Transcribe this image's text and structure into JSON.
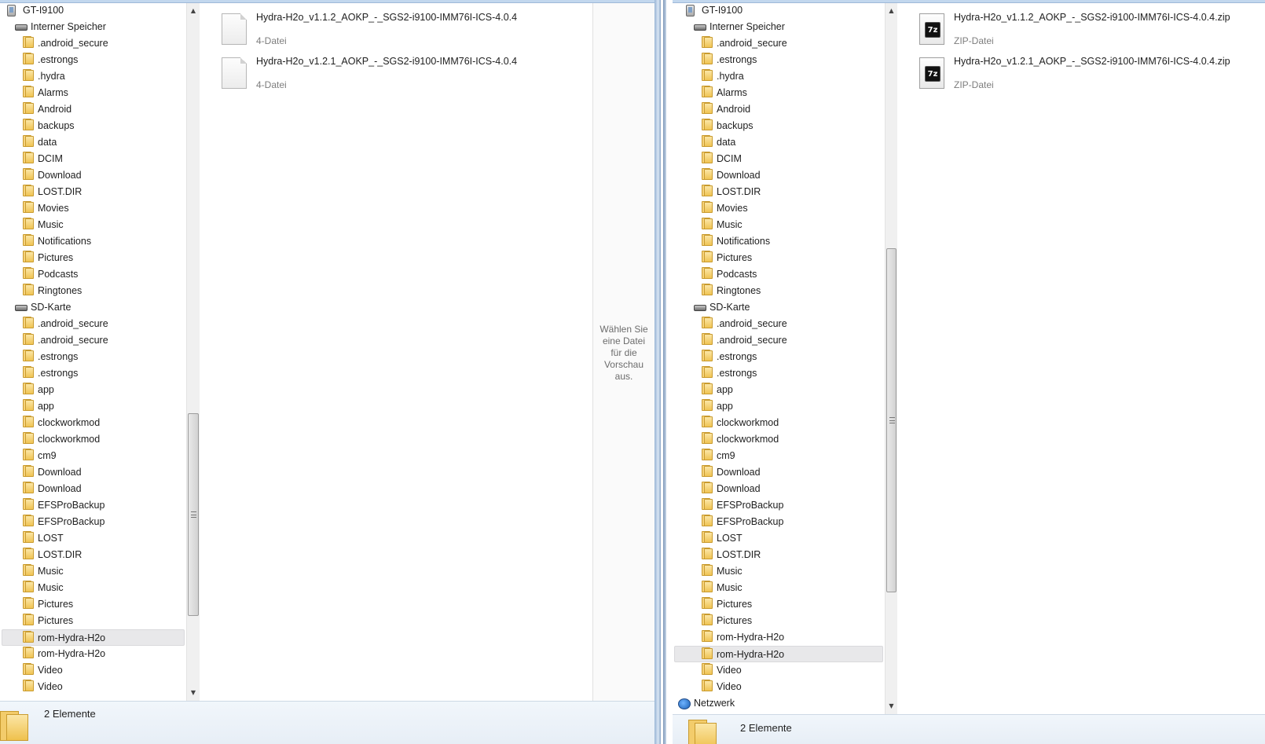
{
  "left": {
    "tree": [
      {
        "label": "GT-I9100",
        "type": "device"
      },
      {
        "label": "Interner Speicher",
        "type": "drive"
      },
      {
        "label": ".android_secure",
        "type": "folder"
      },
      {
        "label": ".estrongs",
        "type": "folder"
      },
      {
        "label": ".hydra",
        "type": "folder"
      },
      {
        "label": "Alarms",
        "type": "folder"
      },
      {
        "label": "Android",
        "type": "folder"
      },
      {
        "label": "backups",
        "type": "folder"
      },
      {
        "label": "data",
        "type": "folder"
      },
      {
        "label": "DCIM",
        "type": "folder"
      },
      {
        "label": "Download",
        "type": "folder"
      },
      {
        "label": "LOST.DIR",
        "type": "folder"
      },
      {
        "label": "Movies",
        "type": "folder"
      },
      {
        "label": "Music",
        "type": "folder"
      },
      {
        "label": "Notifications",
        "type": "folder"
      },
      {
        "label": "Pictures",
        "type": "folder"
      },
      {
        "label": "Podcasts",
        "type": "folder"
      },
      {
        "label": "Ringtones",
        "type": "folder"
      },
      {
        "label": "SD-Karte",
        "type": "drive"
      },
      {
        "label": ".android_secure",
        "type": "folder"
      },
      {
        "label": ".android_secure",
        "type": "folder"
      },
      {
        "label": ".estrongs",
        "type": "folder"
      },
      {
        "label": ".estrongs",
        "type": "folder"
      },
      {
        "label": "app",
        "type": "folder"
      },
      {
        "label": "app",
        "type": "folder"
      },
      {
        "label": "clockworkmod",
        "type": "folder"
      },
      {
        "label": "clockworkmod",
        "type": "folder"
      },
      {
        "label": "cm9",
        "type": "folder"
      },
      {
        "label": "Download",
        "type": "folder"
      },
      {
        "label": "Download",
        "type": "folder"
      },
      {
        "label": "EFSProBackup",
        "type": "folder"
      },
      {
        "label": "EFSProBackup",
        "type": "folder"
      },
      {
        "label": "LOST",
        "type": "folder"
      },
      {
        "label": "LOST.DIR",
        "type": "folder"
      },
      {
        "label": "Music",
        "type": "folder"
      },
      {
        "label": "Music",
        "type": "folder"
      },
      {
        "label": "Pictures",
        "type": "folder"
      },
      {
        "label": "Pictures",
        "type": "folder"
      },
      {
        "label": "rom-Hydra-H2o",
        "type": "folder",
        "selected": true
      },
      {
        "label": "rom-Hydra-H2o",
        "type": "folder"
      },
      {
        "label": "Video",
        "type": "folder"
      },
      {
        "label": "Video",
        "type": "folder"
      }
    ],
    "files": [
      {
        "name": "Hydra-H2o_v1.1.2_AOKP_-_SGS2-i9100-IMM76I-ICS-4.0.4",
        "type": "4-Datei",
        "icon": "generic-file-icon"
      },
      {
        "name": "Hydra-H2o_v1.2.1_AOKP_-_SGS2-i9100-IMM76I-ICS-4.0.4",
        "type": "4-Datei",
        "icon": "generic-file-icon"
      }
    ],
    "preview_message": "Wählen Sie eine Datei für die Vorschau aus.",
    "status": "2 Elemente"
  },
  "right": {
    "tree": [
      {
        "label": "GT-I9100",
        "type": "device"
      },
      {
        "label": "Interner Speicher",
        "type": "drive"
      },
      {
        "label": ".android_secure",
        "type": "folder"
      },
      {
        "label": ".estrongs",
        "type": "folder"
      },
      {
        "label": ".hydra",
        "type": "folder"
      },
      {
        "label": "Alarms",
        "type": "folder"
      },
      {
        "label": "Android",
        "type": "folder"
      },
      {
        "label": "backups",
        "type": "folder"
      },
      {
        "label": "data",
        "type": "folder"
      },
      {
        "label": "DCIM",
        "type": "folder"
      },
      {
        "label": "Download",
        "type": "folder"
      },
      {
        "label": "LOST.DIR",
        "type": "folder"
      },
      {
        "label": "Movies",
        "type": "folder"
      },
      {
        "label": "Music",
        "type": "folder"
      },
      {
        "label": "Notifications",
        "type": "folder"
      },
      {
        "label": "Pictures",
        "type": "folder"
      },
      {
        "label": "Podcasts",
        "type": "folder"
      },
      {
        "label": "Ringtones",
        "type": "folder"
      },
      {
        "label": "SD-Karte",
        "type": "drive"
      },
      {
        "label": ".android_secure",
        "type": "folder"
      },
      {
        "label": ".android_secure",
        "type": "folder"
      },
      {
        "label": ".estrongs",
        "type": "folder"
      },
      {
        "label": ".estrongs",
        "type": "folder"
      },
      {
        "label": "app",
        "type": "folder"
      },
      {
        "label": "app",
        "type": "folder"
      },
      {
        "label": "clockworkmod",
        "type": "folder"
      },
      {
        "label": "clockworkmod",
        "type": "folder"
      },
      {
        "label": "cm9",
        "type": "folder"
      },
      {
        "label": "Download",
        "type": "folder"
      },
      {
        "label": "Download",
        "type": "folder"
      },
      {
        "label": "EFSProBackup",
        "type": "folder"
      },
      {
        "label": "EFSProBackup",
        "type": "folder"
      },
      {
        "label": "LOST",
        "type": "folder"
      },
      {
        "label": "LOST.DIR",
        "type": "folder"
      },
      {
        "label": "Music",
        "type": "folder"
      },
      {
        "label": "Music",
        "type": "folder"
      },
      {
        "label": "Pictures",
        "type": "folder"
      },
      {
        "label": "Pictures",
        "type": "folder"
      },
      {
        "label": "rom-Hydra-H2o",
        "type": "folder"
      },
      {
        "label": "rom-Hydra-H2o",
        "type": "folder",
        "selected": true
      },
      {
        "label": "Video",
        "type": "folder"
      },
      {
        "label": "Video",
        "type": "folder"
      },
      {
        "label": "Netzwerk",
        "type": "network"
      }
    ],
    "files": [
      {
        "name": "Hydra-H2o_v1.1.2_AOKP_-_SGS2-i9100-IMM76I-ICS-4.0.4.zip",
        "type": "ZIP-Datei",
        "icon": "7z-archive-icon",
        "badge": "7z"
      },
      {
        "name": "Hydra-H2o_v1.2.1_AOKP_-_SGS2-i9100-IMM76I-ICS-4.0.4.zip",
        "type": "ZIP-Datei",
        "icon": "7z-archive-icon",
        "badge": "7z"
      }
    ],
    "status": "2 Elemente"
  },
  "colors": {
    "selected_row": "#e8e8ea",
    "window_frame": "#9ab6d6",
    "status_bar": "#e7eef6",
    "folder": "#f3cc6b"
  }
}
